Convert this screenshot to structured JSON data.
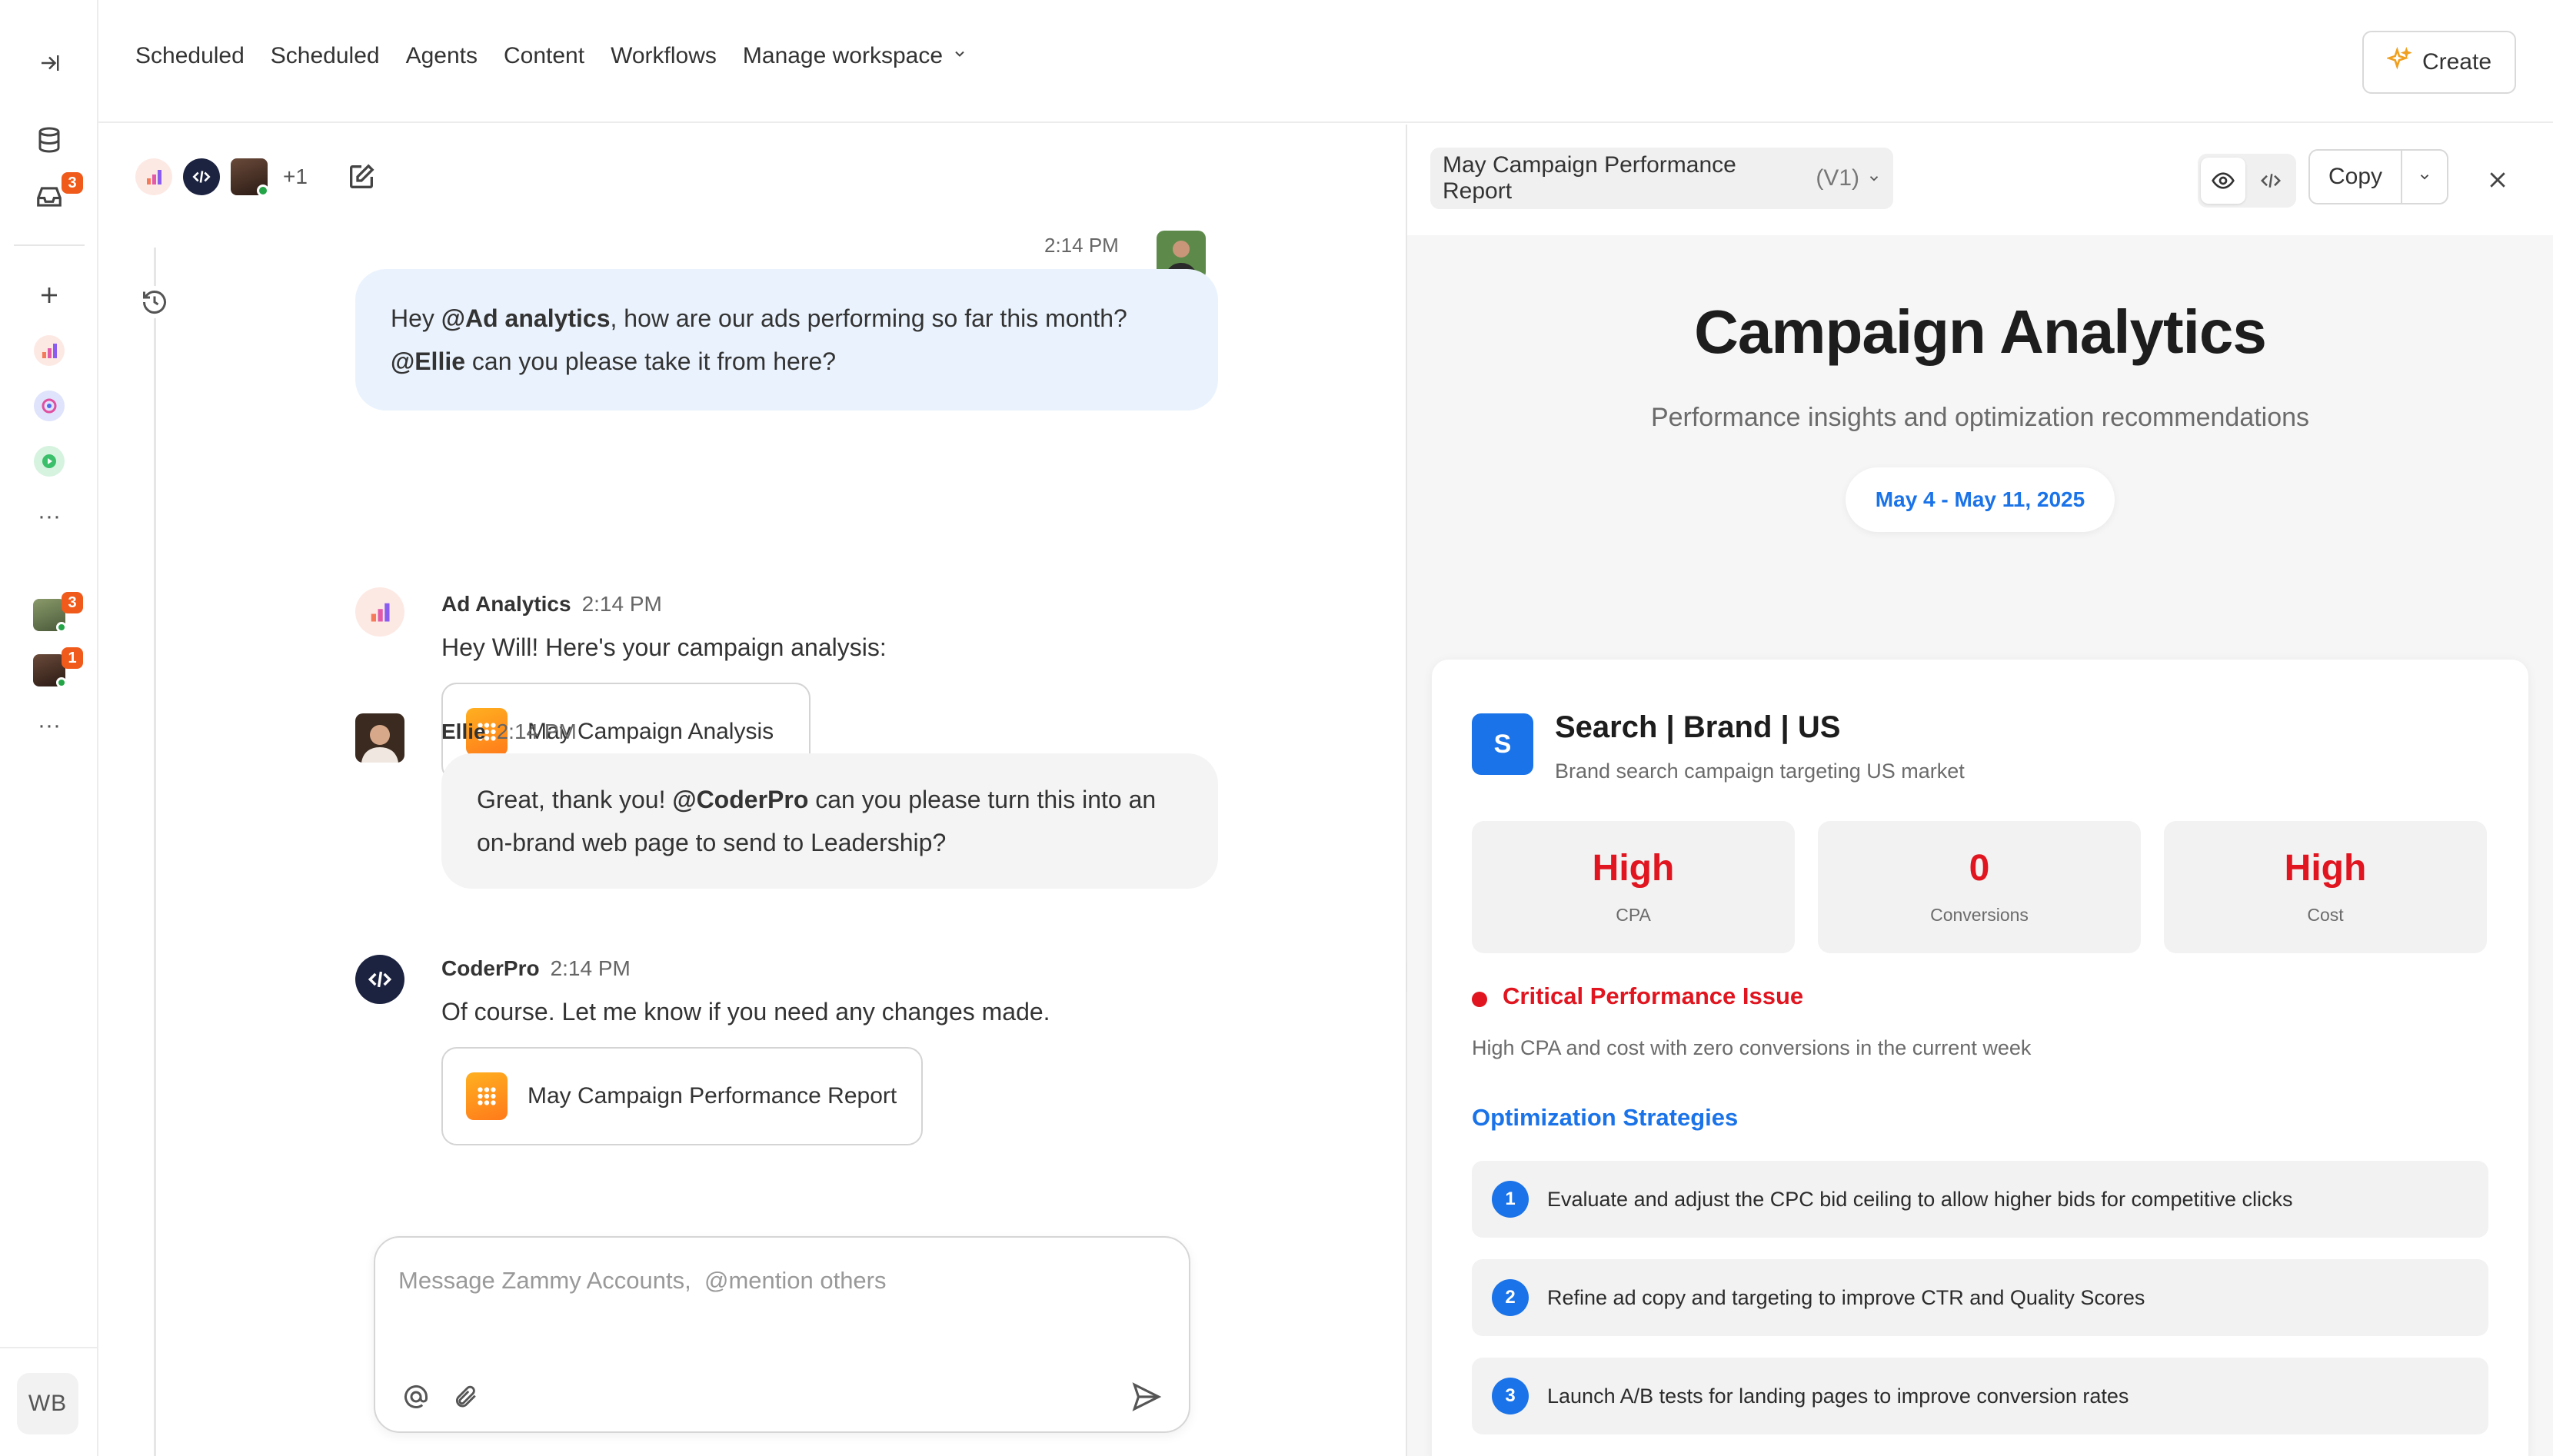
{
  "nav": {
    "links": [
      "Scheduled",
      "Scheduled",
      "Agents",
      "Content",
      "Workflows",
      "Manage workspace"
    ],
    "create_label": "Create"
  },
  "rail": {
    "inbox_badge": "3",
    "dm_badges": [
      "3",
      "1"
    ],
    "more": "···",
    "user_initials": "WB"
  },
  "chat": {
    "participants_extra": "+1",
    "user_message": {
      "time": "2:14 PM",
      "pre": "Hey ",
      "mention1": "@Ad analytics",
      "mid": ", how are our ads performing so far this month? ",
      "mention2": "@Ellie",
      "post": " can you please take it from here?"
    },
    "ad_analytics": {
      "name": "Ad Analytics",
      "time": "2:14 PM",
      "text": "Hey Will! Here's your campaign analysis:",
      "file": "May Campaign Analysis"
    },
    "ellie": {
      "name": "Ellie",
      "time": "2:14 PM",
      "pre": "Great, thank you! ",
      "mention": "@CoderPro",
      "post": " can you please turn this into an on-brand web page to send to Leadership?"
    },
    "coderpro": {
      "name": "CoderPro",
      "time": "2:14 PM",
      "text": "Of course. Let me know if you need any changes made.",
      "file": "May Campaign Performance Report"
    },
    "composer_placeholder": "Message Zammy Accounts,  @mention others"
  },
  "panel": {
    "doc_title": "May Campaign Performance Report",
    "doc_version": "(V1)",
    "copy_label": "Copy",
    "title": "Campaign Analytics",
    "subtitle": "Performance insights and optimization recommendations",
    "date_range": "May 4 - May 11, 2025",
    "campaign": {
      "badge": "S",
      "name": "Search | Brand | US",
      "description": "Brand search campaign targeting US market",
      "metrics": [
        {
          "value": "High",
          "label": "CPA",
          "color": "#e0151f"
        },
        {
          "value": "0",
          "label": "Conversions",
          "color": "#e0151f"
        },
        {
          "value": "High",
          "label": "Cost",
          "color": "#e0151f"
        }
      ],
      "issue_title": "Critical Performance Issue",
      "issue_desc": "High CPA and cost with zero conversions in the current week",
      "strategies_title": "Optimization Strategies",
      "strategies": [
        {
          "num": "1",
          "text": "Evaluate and adjust the CPC bid ceiling to allow higher bids for competitive clicks"
        },
        {
          "num": "2",
          "text": "Refine ad copy and targeting to improve CTR and Quality Scores"
        },
        {
          "num": "3",
          "text": "Launch A/B tests for landing pages to improve conversion rates"
        }
      ]
    }
  },
  "colors": {
    "accent_blue": "#1a73e8",
    "critical_red": "#e0151f",
    "badge_orange": "#f05a1a",
    "user_bubble": "#eaf3fd"
  }
}
